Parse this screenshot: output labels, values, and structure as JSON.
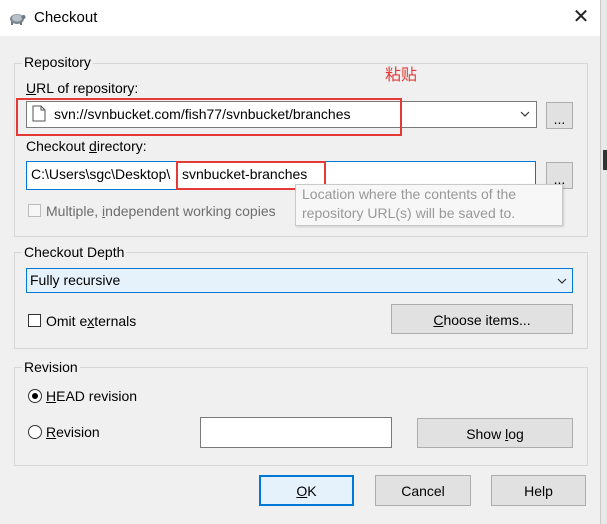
{
  "window": {
    "title": "Checkout",
    "close_icon": "close-icon"
  },
  "annotation": {
    "text": "粘贴",
    "color": "#e53935"
  },
  "repository": {
    "legend": "Repository",
    "url_label": "URL of repository:",
    "url_value": "svn://svnbucket.com/fish77/svnbucket/branches",
    "browse_label": "...",
    "dir_label": "Checkout directory:",
    "dir_value_prefix": "C:\\Users\\sgc\\Desktop\\",
    "dir_value_highlight": "svnbucket-branches",
    "dir_browse_label": "...",
    "multiple_label": "Multiple, independent working copies",
    "tooltip_line1": "Location where the contents of the",
    "tooltip_line2": "repository URL(s) will be saved to."
  },
  "depth": {
    "legend": "Checkout Depth",
    "selected": "Fully recursive",
    "omit_label": "Omit externals",
    "choose_items_label": "Choose items..."
  },
  "revision": {
    "legend": "Revision",
    "head_label": "HEAD revision",
    "revision_label": "Revision",
    "revision_value": "",
    "show_log_label": "Show log"
  },
  "buttons": {
    "ok": "OK",
    "cancel": "Cancel",
    "help": "Help"
  },
  "colors": {
    "accent": "#0078d7",
    "highlight_box": "#e53935",
    "dialog_bg": "#f0f0f0"
  }
}
